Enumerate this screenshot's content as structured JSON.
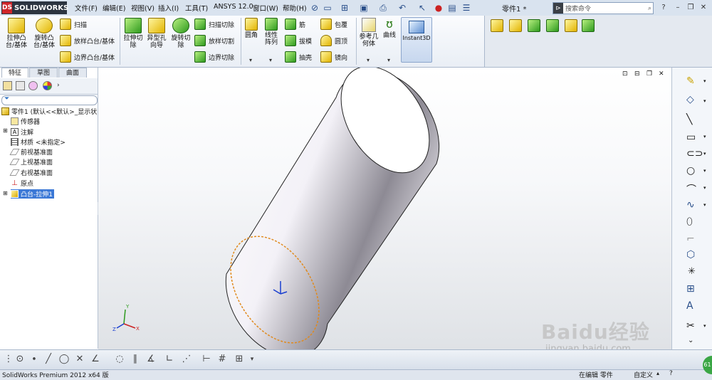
{
  "app": {
    "logo": "SOLIDWORKS",
    "doc_title": "零件1 *"
  },
  "menu": [
    "文件(F)",
    "编辑(E)",
    "视图(V)",
    "插入(I)",
    "工具(T)",
    "ANSYS 12.0",
    "窗口(W)",
    "帮助(H)"
  ],
  "search": {
    "placeholder": "搜索命令"
  },
  "ribbon": {
    "extrude_boss": "拉伸凸台/基体",
    "revolve_boss": "旋转凸台/基体",
    "sweep": "扫描",
    "loft_boss": "放样凸台/基体",
    "boundary_boss": "边界凸台/基体",
    "extrude_cut": "拉伸切除",
    "hole_wizard": "异型孔向导",
    "revolve_cut": "旋转切除",
    "sweep_cut": "扫描切除",
    "loft_cut": "放样切割",
    "boundary_cut": "边界切除",
    "fillet": "圆角",
    "linear_pattern": "线性阵列",
    "rib": "筋",
    "draft": "拔模",
    "shell": "抽壳",
    "wrap": "包覆",
    "dome": "圆顶",
    "mirror": "镜向",
    "ref_geometry": "参考几何体",
    "curves": "曲线",
    "instant3d": "Instant3D"
  },
  "tabs": [
    "特征",
    "草图",
    "曲面"
  ],
  "tree": {
    "root": "零件1 (默认<<默认>_显示状",
    "items": [
      "传感器",
      "注解",
      "材质 <未指定>",
      "前视基准面",
      "上视基准面",
      "右视基准面",
      "原点",
      "凸台-拉伸1"
    ]
  },
  "status": {
    "product": "SolidWorks Premium 2012 x64 版",
    "mode": "在编辑 零件",
    "units": "自定义"
  },
  "watermark": {
    "brand": "Baidu经验",
    "url": "jingyan.baidu.com"
  },
  "colors": {
    "accent": "#2c3440",
    "selection": "#e08a1e",
    "ribbon_bg": "#eef2f7"
  }
}
